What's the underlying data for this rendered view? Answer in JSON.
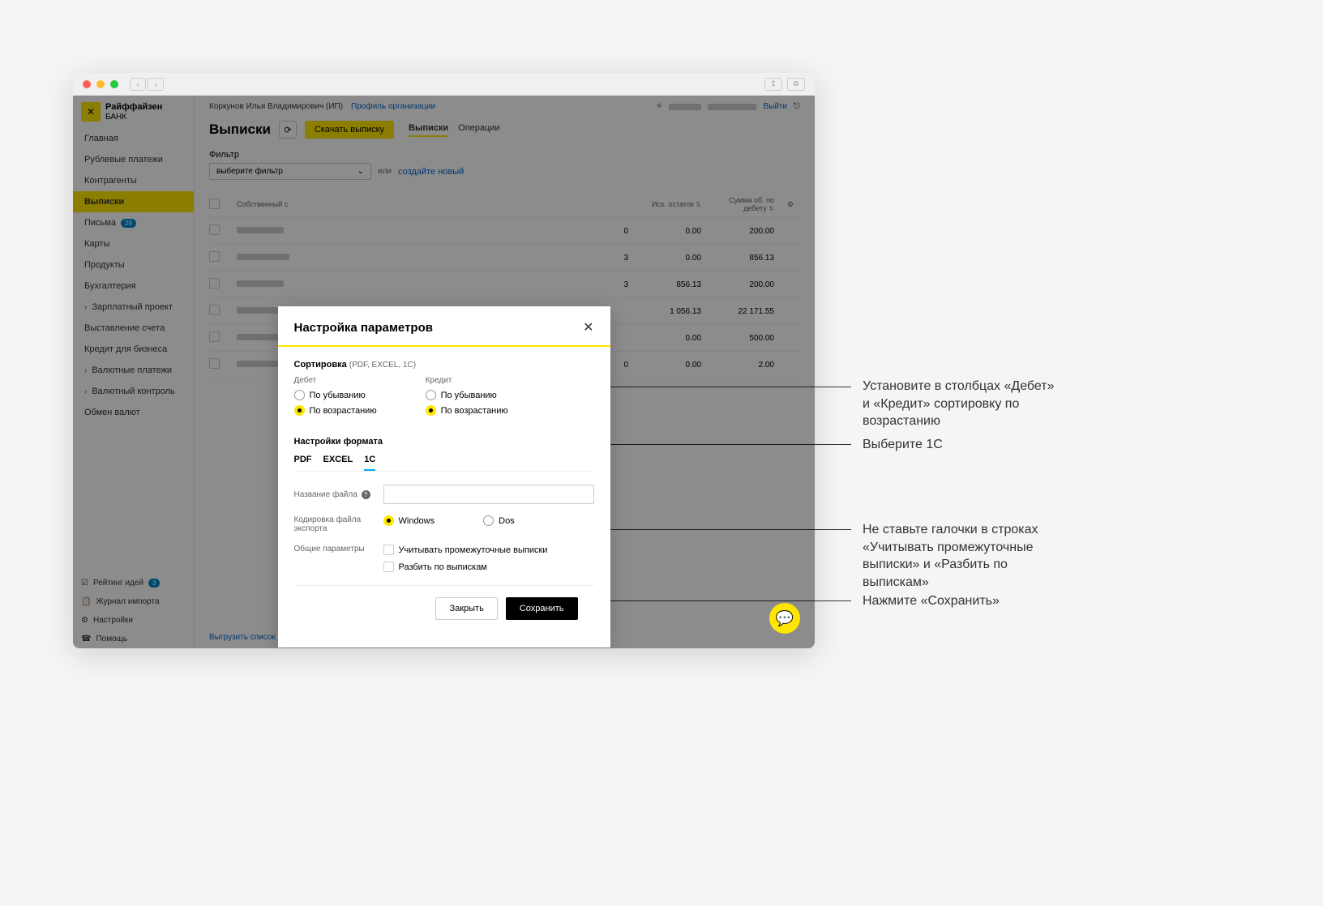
{
  "bank": {
    "name": "Райффайзен",
    "sub": "БАНК"
  },
  "header": {
    "user": "Коркунов Илья Владимирович (ИП)",
    "profileLink": "Профиль организации",
    "logout": "Выйти"
  },
  "sidebar": {
    "items": [
      {
        "label": "Главная"
      },
      {
        "label": "Рублевые платежи"
      },
      {
        "label": "Контрагенты"
      },
      {
        "label": "Выписки",
        "active": true
      },
      {
        "label": "Письма",
        "badge": "29"
      },
      {
        "label": "Карты"
      },
      {
        "label": "Продукты"
      },
      {
        "label": "Бухгалтерия"
      },
      {
        "label": "Зарплатный проект",
        "expandable": true
      },
      {
        "label": "Выставление счета"
      },
      {
        "label": "Кредит для бизнеса"
      },
      {
        "label": "Валютные платежи",
        "expandable": true
      },
      {
        "label": "Валютный контроль",
        "expandable": true
      },
      {
        "label": "Обмен валют"
      }
    ],
    "bottom": [
      {
        "label": "Рейтинг идей",
        "icon": "☑",
        "badge": "3"
      },
      {
        "label": "Журнал импорта",
        "icon": "📋"
      },
      {
        "label": "Настройки",
        "icon": "⚙"
      },
      {
        "label": "Помощь",
        "icon": "☎"
      }
    ]
  },
  "page": {
    "title": "Выписки",
    "downloadBtn": "Скачать выписку",
    "tabs": [
      {
        "label": "Выписки",
        "active": true
      },
      {
        "label": "Операции"
      }
    ],
    "filterLabel": "Фильтр",
    "filterPlaceholder": "выберите фильтр",
    "filterOr": "или",
    "filterCreate": "создайте новый",
    "exportLink": "Выгрузить список в Excel"
  },
  "table": {
    "headers": {
      "own": "Собственный с",
      "balance": "Исх. остаток",
      "debit": "Сумма об. по дебету"
    },
    "rows": [
      {
        "c1": "0",
        "balance": "0.00",
        "debit": "200.00"
      },
      {
        "c1": "3",
        "balance": "0.00",
        "debit": "856.13"
      },
      {
        "c1": "3",
        "balance": "856.13",
        "debit": "200.00"
      },
      {
        "c1": "",
        "balance": "1 056.13",
        "debit": "22 171.55"
      },
      {
        "c1": "",
        "balance": "0.00",
        "debit": "500.00"
      },
      {
        "c1": "0",
        "balance": "0.00",
        "debit": "2.00"
      }
    ]
  },
  "modal": {
    "title": "Настройка параметров",
    "sortLabel": "Сортировка",
    "sortSub": "(PDF, EXCEL, 1C)",
    "debitLabel": "Дебет",
    "creditLabel": "Кредит",
    "desc": "По убыванию",
    "asc": "По возрастанию",
    "formatLabel": "Настройки формата",
    "formatTabs": [
      {
        "label": "PDF"
      },
      {
        "label": "EXCEL"
      },
      {
        "label": "1C",
        "active": true
      }
    ],
    "filenameLabel": "Название файла",
    "encodingLabel": "Кодировка файла экспорта",
    "encodingOptions": {
      "windows": "Windows",
      "dos": "Dos"
    },
    "generalLabel": "Общие параметры",
    "checkIntermediate": "Учитывать промежуточные выписки",
    "checkSplit": "Разбить по выпискам",
    "closeBtn": "Закрыть",
    "saveBtn": "Сохранить"
  },
  "annotations": {
    "sort": "Установите в столбцах «Дебет» и «Кредит» сортировку по возрастанию",
    "tab": "Выберите 1С",
    "checks": "Не ставьте галочки в строках «Учитывать промежуточные выписки» и «Разбить по выпискам»",
    "save": "Нажмите «Сохранить»"
  }
}
